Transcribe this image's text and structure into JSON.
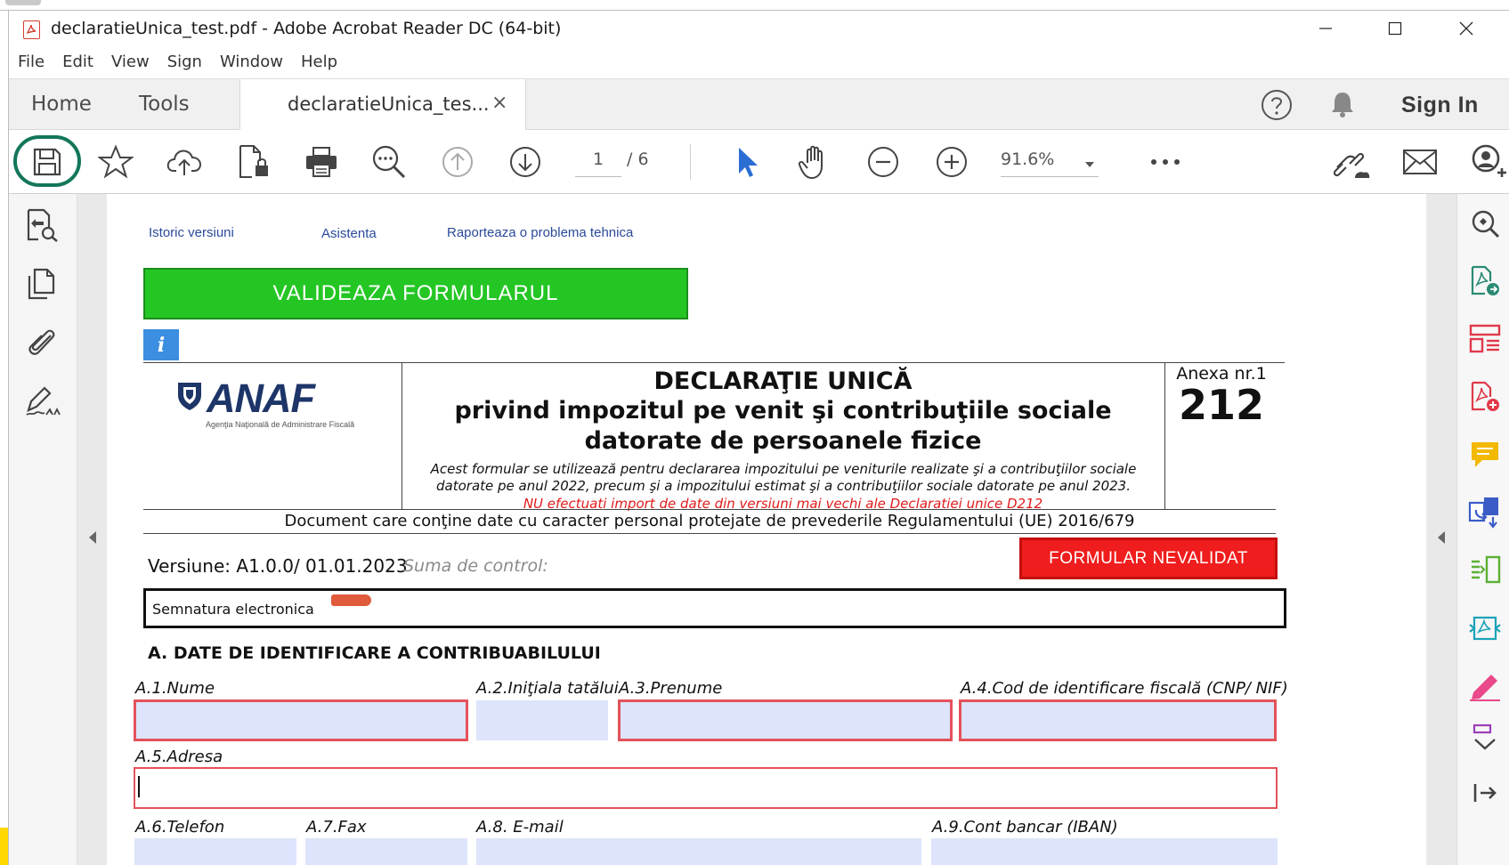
{
  "window": {
    "title": "declaratieUnica_test.pdf - Adobe Acrobat Reader DC (64-bit)"
  },
  "menu": [
    "File",
    "Edit",
    "View",
    "Sign",
    "Window",
    "Help"
  ],
  "nav": {
    "home": "Home",
    "tools": "Tools",
    "tab_label": "declaratieUnica_tes...",
    "tab_close": "×",
    "sign_in": "Sign In"
  },
  "toolbar": {
    "page_current": "1",
    "page_total": "/ 6",
    "zoom": "91.6%",
    "icons": [
      "save-icon",
      "bookmark-star-icon",
      "upload-cloud-icon",
      "file-lock-icon",
      "print-icon",
      "search-zoom-icon",
      "page-up-icon",
      "page-down-icon",
      "select-cursor-icon",
      "hand-tool-icon",
      "zoom-out-icon",
      "zoom-in-icon",
      "more-icon",
      "share-link-icon",
      "mail-icon",
      "account-add-icon"
    ]
  },
  "document": {
    "links": {
      "history": "Istoric versiuni",
      "assist": "Asistenta",
      "report": "Raporteaza o problema tehnica"
    },
    "validate_button": "VALIDEAZA FORMULARUL",
    "info_button": "i",
    "logo_text": "ANAF",
    "logo_subtext": "Agenţia Naţională de Administrare Fiscală",
    "title": "DECLARAŢIE UNICĂ",
    "subtitle_line1": "privind impozitul pe venit şi contribuţiile sociale",
    "subtitle_line2": "datorate de persoanele fizice",
    "note": "Acest formular se utilizează pentru declararea impozitului pe veniturile realizate şi a contribuţiilor sociale datorate pe anul 2022, precum şi a impozitului estimat şi a contribuţiilor sociale datorate pe anul 2023.",
    "warning": "NU efectuati import de date din versiuni mai vechi ale Declaratiei unice D212",
    "anexa_label": "Anexa nr.1",
    "anexa_number": "212",
    "gdpr": "Document care conţine date cu caracter personal protejate de prevederile Regulamentului (UE) 2016/679",
    "version": "Versiune:  A1.0.0/ 01.01.2023",
    "checksum_label": "Suma de  control:",
    "status_button": "FORMULAR NEVALIDAT",
    "signature_label": "Semnatura electronica",
    "section_a": "A. DATE DE IDENTIFICARE A CONTRIBUABILULUI",
    "fields": {
      "a1": "A.1.Nume",
      "a2": "A.2.Iniţiala tatălui",
      "a3": "A.3.Prenume",
      "a4": "A.4.Cod de identificare fiscală (CNP/ NIF)",
      "a5": "A.5.Adresa",
      "a6": "A.6.Telefon",
      "a7": "A.7.Fax",
      "a8": "A.8. E-mail",
      "a9": "A.9.Cont bancar (IBAN)"
    }
  },
  "colors": {
    "validate_green": "#24c624",
    "status_red": "#ef1d1d",
    "required_border": "#e3525b",
    "field_fill": "#dde4fb",
    "highlight_ring": "#12765a"
  }
}
